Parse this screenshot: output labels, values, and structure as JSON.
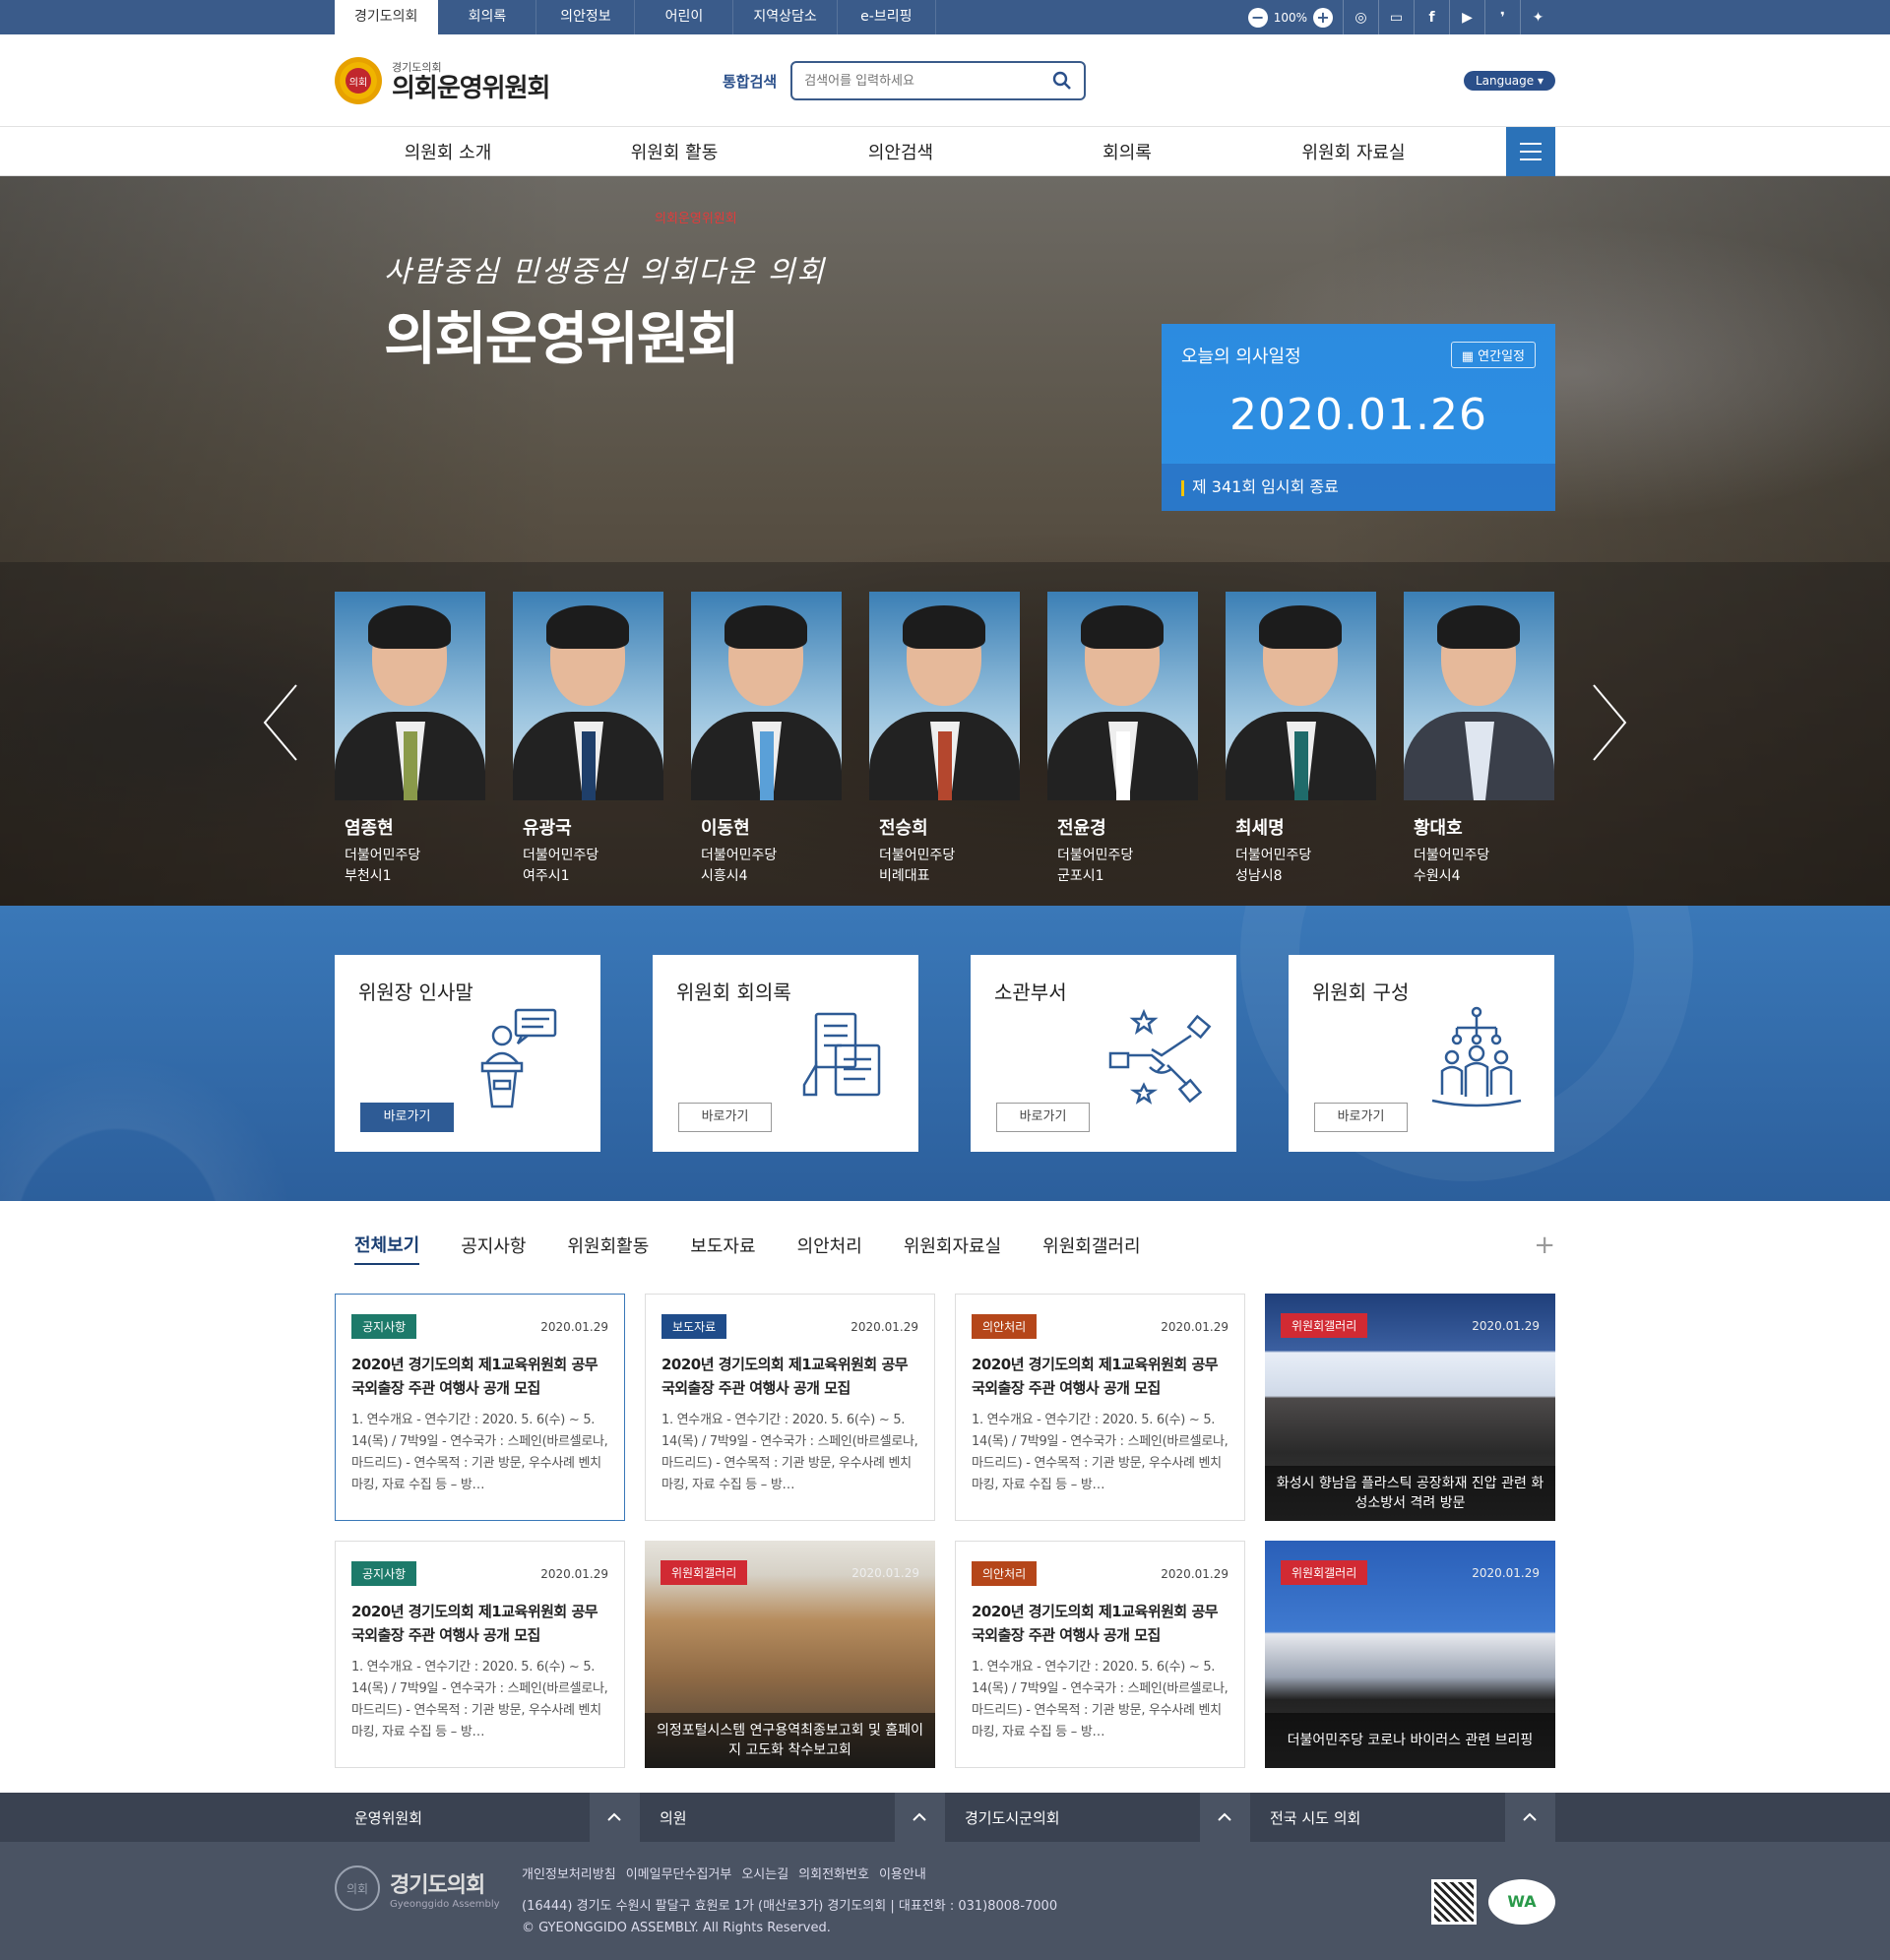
{
  "topbar": {
    "tabs": [
      "경기도의회",
      "회의록",
      "의안정보",
      "어린이",
      "지역상담소",
      "e-브리핑"
    ],
    "zoom": "100%",
    "sns": [
      "instagram-icon",
      "talk-icon",
      "facebook-icon",
      "youtube-icon",
      "blog-icon",
      "twitter-icon"
    ]
  },
  "header": {
    "logo_small": "경기도의회",
    "logo_title": "의회운영위원회",
    "logo_emblem": "의회",
    "search_label": "통합검색",
    "search_placeholder": "검색어를 입력하세요",
    "language": "Language ▾"
  },
  "gnb": [
    "의원회 소개",
    "위원회 활동",
    "의안검색",
    "회의록",
    "위원회 자료실"
  ],
  "visual": {
    "sub": "의회운영위원회",
    "slogan": "사람중심 민생중심 의회다운 의회",
    "title": "의회운영위원회",
    "today": {
      "heading": "오늘의 의사일정",
      "yearly": "연간일정",
      "date": "2020.01.26",
      "event": "제 341회 임시회 종료"
    }
  },
  "members": [
    {
      "name": "염종현",
      "party": "더불어민주당",
      "district": "부천시1"
    },
    {
      "name": "유광국",
      "party": "더불어민주당",
      "district": "여주시1"
    },
    {
      "name": "이동현",
      "party": "더불어민주당",
      "district": "시흥시4"
    },
    {
      "name": "전승희",
      "party": "더불어민주당",
      "district": "비례대표"
    },
    {
      "name": "전윤경",
      "party": "더불어민주당",
      "district": "군포시1"
    },
    {
      "name": "최세명",
      "party": "더불어민주당",
      "district": "성남시8"
    },
    {
      "name": "황대호",
      "party": "더불어민주당",
      "district": "수원시4"
    }
  ],
  "quick": [
    {
      "title": "위원장 인사말",
      "button": "바로가기",
      "icon": "speaker-podium-icon"
    },
    {
      "title": "위원회 회의록",
      "button": "바로가기",
      "icon": "documents-icon"
    },
    {
      "title": "소관부서",
      "button": "바로가기",
      "icon": "teamwork-hands-icon"
    },
    {
      "title": "위원회 구성",
      "button": "바로가기",
      "icon": "organization-icon"
    }
  ],
  "board": {
    "tabs": [
      "전체보기",
      "공지사항",
      "위원회활동",
      "보도자료",
      "의안처리",
      "위원회자료실",
      "위원회갤러리"
    ],
    "more": "+",
    "cards": [
      {
        "badge": "공지사항",
        "date": "2020.01.29",
        "title": "2020년 경기도의회 제1교육위원회 공무국외출장 주관 여행사 공개 모집",
        "body": "1. 연수개요 - 연수기간 : 2020. 5. 6(수) ~ 5. 14(목) / 7박9일 - 연수국가 : 스페인(바르셀로나, 마드리드) - 연수목적 : 기관 방문, 우수사례 벤치마킹, 자료 수집 등 – 방…"
      },
      {
        "badge": "보도자료",
        "date": "2020.01.29",
        "title": "2020년 경기도의회 제1교육위원회 공무국외출장 주관 여행사 공개 모집",
        "body": "1. 연수개요 - 연수기간 : 2020. 5. 6(수) ~ 5. 14(목) / 7박9일 - 연수국가 : 스페인(바르셀로나, 마드리드) - 연수목적 : 기관 방문, 우수사례 벤치마킹, 자료 수집 등 – 방…"
      },
      {
        "badge": "의안처리",
        "date": "2020.01.29",
        "title": "2020년 경기도의회 제1교육위원회 공무국외출장 주관 여행사 공개 모집",
        "body": "1. 연수개요 - 연수기간 : 2020. 5. 6(수) ~ 5. 14(목) / 7박9일 - 연수국가 : 스페인(바르셀로나, 마드리드) - 연수목적 : 기관 방문, 우수사례 벤치마킹, 자료 수집 등 – 방…"
      },
      {
        "badge": "위원회갤러리",
        "date": "2020.01.29",
        "caption": "화성시 향남읍 플라스틱 공장화재 진압 관련 화성소방서 격려 방문"
      },
      {
        "badge": "공지사항",
        "date": "2020.01.29",
        "title": "2020년 경기도의회 제1교육위원회 공무국외출장 주관 여행사 공개 모집",
        "body": "1. 연수개요 - 연수기간 : 2020. 5. 6(수) ~ 5. 14(목) / 7박9일 - 연수국가 : 스페인(바르셀로나, 마드리드) - 연수목적 : 기관 방문, 우수사례 벤치마킹, 자료 수집 등 – 방…"
      },
      {
        "badge": "위원회갤러리",
        "date": "2020.01.29",
        "caption": "의정포털시스템 연구용역최종보고회 및 홈페이지 고도화 착수보고회"
      },
      {
        "badge": "의안처리",
        "date": "2020.01.29",
        "title": "2020년 경기도의회 제1교육위원회 공무국외출장 주관 여행사 공개 모집",
        "body": "1. 연수개요 - 연수기간 : 2020. 5. 6(수) ~ 5. 14(목) / 7박9일 - 연수국가 : 스페인(바르셀로나, 마드리드) - 연수목적 : 기관 방문, 우수사례 벤치마킹, 자료 수집 등 – 방…"
      },
      {
        "badge": "위원회갤러리",
        "date": "2020.01.29",
        "caption": "더불어민주당 코로나 바이러스 관련 브리핑"
      }
    ]
  },
  "footer": {
    "selects": [
      "운영위원회",
      "의원",
      "경기도시군의회",
      "전국 시도 의회"
    ],
    "logo_title": "경기도의회",
    "logo_sub": "Gyeonggido Assembly",
    "links": [
      "개인정보처리방침",
      "이메일무단수집거부",
      "오시는길",
      "의회전화번호",
      "이용안내"
    ],
    "address": "(16444) 경기도 수원시 팔달구 효원로 1가 (매산로3가) 경기도의회  |  대표전화 : 031)8008-7000",
    "copyright": "© GYEONGGIDO ASSEMBLY. All Rights Reserved.",
    "wa": "WA"
  }
}
